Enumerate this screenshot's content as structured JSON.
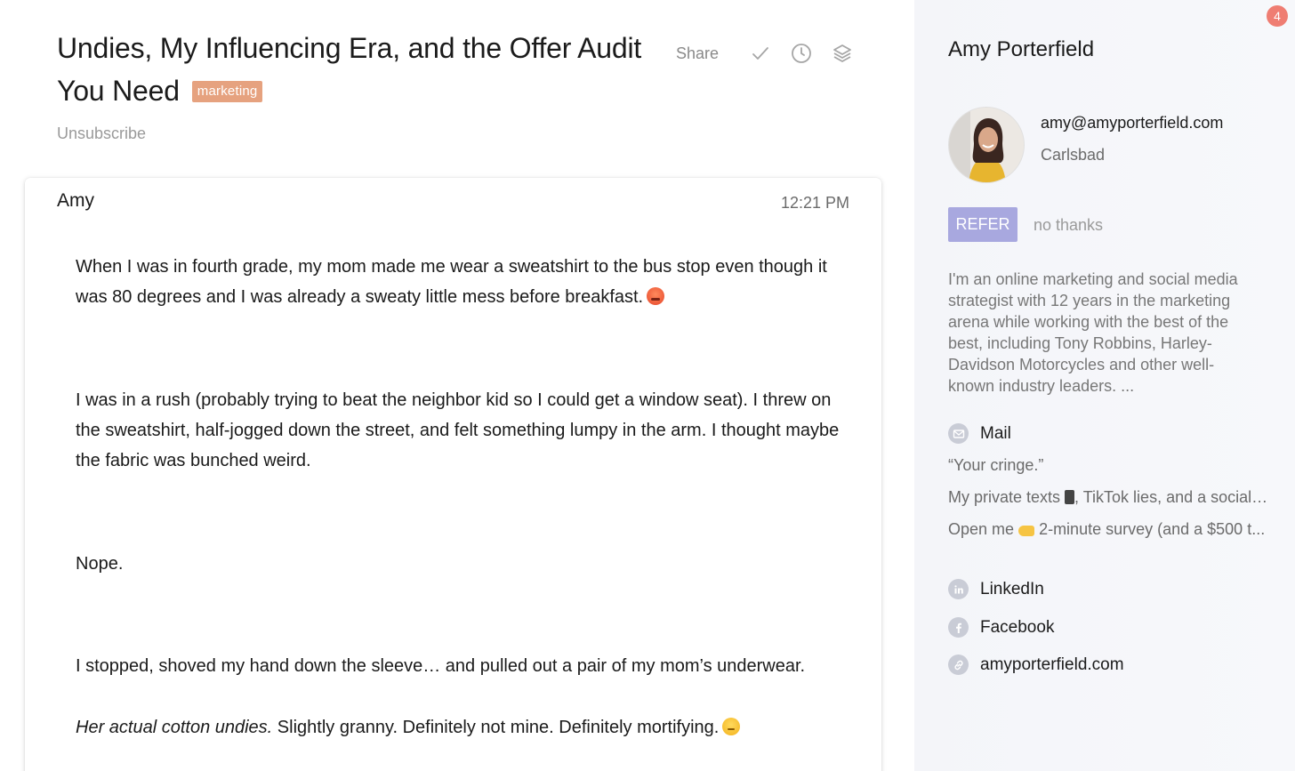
{
  "email": {
    "subject": "Undies, My Influencing Era, and the Offer Audit You Need",
    "tag": "marketing",
    "unsubscribe_label": "Unsubscribe",
    "share_label": "Share",
    "sender": "Amy",
    "time": "12:21 PM",
    "paragraphs": {
      "p1": "When I was in fourth grade, my mom made me wear a sweatshirt to the bus stop even though it was 80 degrees and I was already a sweaty little mess before breakfast.",
      "p2": "I was in a rush (probably trying to beat the neighbor kid so I could get a window seat). I threw on the sweatshirt, half-jogged down the street, and felt something lumpy in the arm. I thought maybe the fabric was bunched weird.",
      "p3": "Nope.",
      "p4": "I stopped, shoved my hand down the sleeve… and pulled out a pair of my mom’s underwear.",
      "p5_italic": "Her actual cotton undies.",
      "p5_rest": " Slightly granny. Definitely not mine. Definitely mortifying."
    }
  },
  "sidebar": {
    "badge_count": "4",
    "name": "Amy Porterfield",
    "email": "amy@amyporterfield.com",
    "city": "Carlsbad",
    "refer_label": "REFER",
    "no_thanks_label": "no thanks",
    "bio": "I'm an online marketing and social media strategist with 12 years in the marketing arena while working with the best of the best, including Tony Robbins, Harley-Davidson Motorcycles and other well-known industry leaders. ...",
    "mail_label": "Mail",
    "recent_mail": {
      "m1": "“Your cringe.”",
      "m2_a": "My private texts ",
      "m2_b": ", TikTok lies, and a social media...",
      "m3_a": "Open me ",
      "m3_b": "2-minute survey (and a $500 t..."
    },
    "links": {
      "linkedin": "LinkedIn",
      "facebook": "Facebook",
      "website": "amyporterfield.com"
    }
  },
  "colors": {
    "tag_bg": "#e6a27f",
    "refer_bg": "#a8a8df",
    "badge_bg": "#ef7d72",
    "sidebar_bg": "#f5f6fa"
  },
  "icons": [
    "check-icon",
    "clock-icon",
    "layers-icon",
    "mail-icon",
    "linkedin-icon",
    "facebook-icon",
    "link-icon"
  ]
}
